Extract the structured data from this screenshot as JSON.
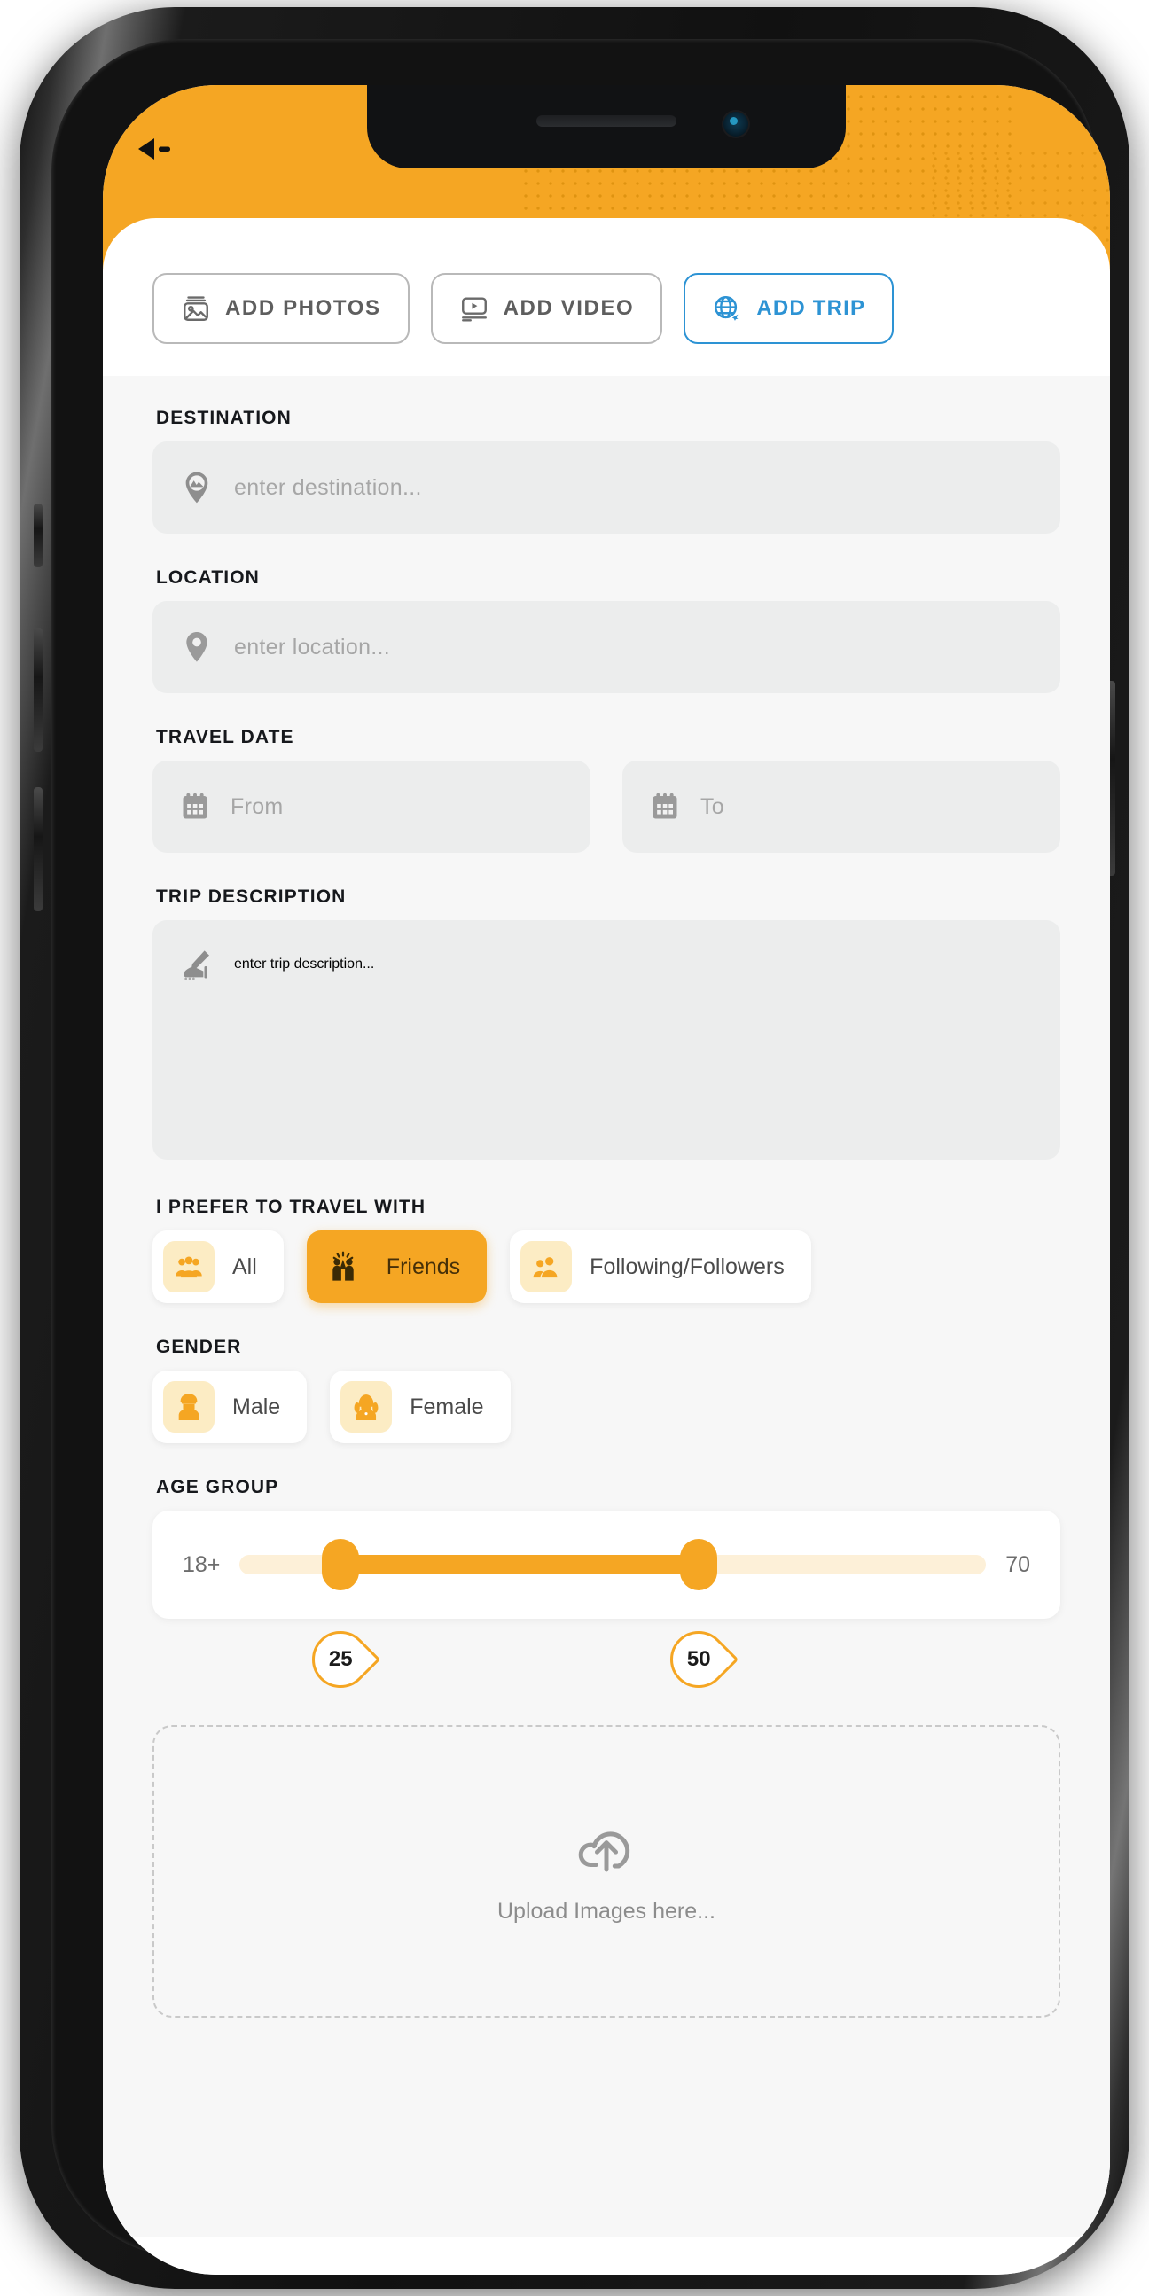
{
  "app": {
    "accent_orange": "#f5a623",
    "accent_blue": "#2d93d4",
    "field_bg": "#eceded"
  },
  "header": {
    "back_icon": "back-arrow-icon"
  },
  "tabs": [
    {
      "label": "ADD  PHOTOS",
      "icon": "photo-icon",
      "active": false
    },
    {
      "label": "ADD  VIDEO",
      "icon": "video-icon",
      "active": false
    },
    {
      "label": "ADD TRIP",
      "icon": "globe-plane-icon",
      "active": true
    }
  ],
  "form": {
    "destination": {
      "label": "DESTINATION",
      "placeholder": "enter destination...",
      "value": "",
      "icon": "destination-pin-icon"
    },
    "location": {
      "label": "LOCATION",
      "placeholder": "enter location...",
      "value": "",
      "icon": "map-pin-icon"
    },
    "travel_date": {
      "label": "TRAVEL DATE",
      "from_placeholder": "From",
      "from_value": "",
      "to_placeholder": "To",
      "to_value": "",
      "icon": "calendar-icon"
    },
    "trip_description": {
      "label": "TRIP DESCRIPTION",
      "placeholder": "enter trip description...",
      "value": "",
      "icon": "write-hand-icon"
    },
    "travel_with": {
      "label": "I PREFER TO TRAVEL WITH",
      "options": [
        {
          "label": "All",
          "icon": "group-icon",
          "selected": false
        },
        {
          "label": "Friends",
          "icon": "friends-highfive-icon",
          "selected": true
        },
        {
          "label": "Following/Followers",
          "icon": "two-people-icon",
          "selected": false
        }
      ]
    },
    "gender": {
      "label": "GENDER",
      "options": [
        {
          "label": "Male",
          "icon": "male-avatar-icon",
          "selected": false
        },
        {
          "label": "Female",
          "icon": "female-avatar-icon",
          "selected": false
        }
      ]
    },
    "age_group": {
      "label": "AGE GROUP",
      "min_label": "18+",
      "max_label": "70",
      "min": 18,
      "max": 70,
      "low_value": "25",
      "high_value": "50"
    },
    "upload": {
      "text": "Upload Images here...",
      "icon": "cloud-upload-icon"
    }
  }
}
